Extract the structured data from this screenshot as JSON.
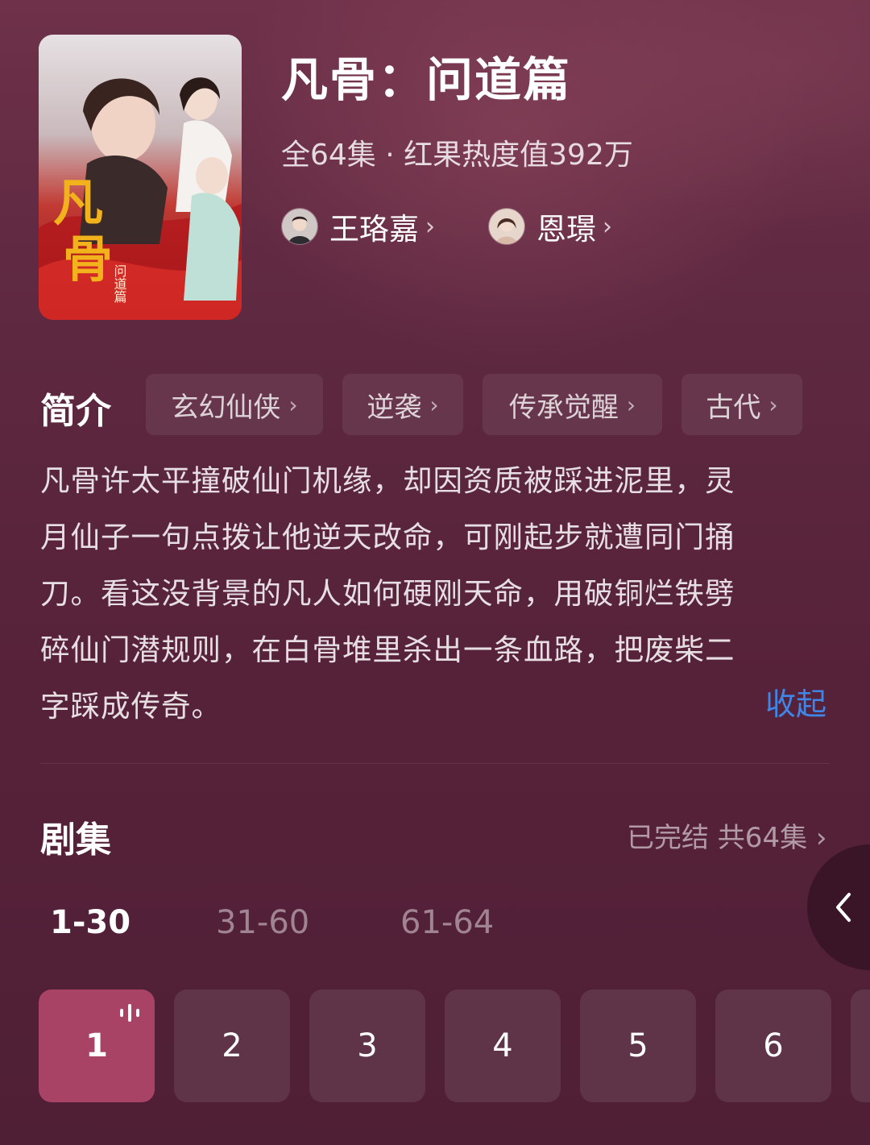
{
  "colors": {
    "accent_link": "#3f86e6",
    "active_episode": "#a84366",
    "background": "#58243a"
  },
  "drama": {
    "title": "凡骨：问道篇",
    "meta": "全64集 · 红果热度值392万",
    "poster_icon": "poster-image"
  },
  "cast": [
    {
      "name": "王珞嘉",
      "chevron": "›"
    },
    {
      "name": "恩璟",
      "chevron": "›"
    }
  ],
  "intro": {
    "heading": "简介",
    "tags": [
      {
        "label": "玄幻仙侠",
        "chevron": "›"
      },
      {
        "label": "逆袭",
        "chevron": "›"
      },
      {
        "label": "传承觉醒",
        "chevron": "›"
      },
      {
        "label": "古代",
        "chevron": "›"
      }
    ],
    "lines": [
      "凡骨许太平撞破仙门机缘，却因资质被踩进泥里，灵",
      "月仙子一句点拨让他逆天改命，可刚起步就遭同门捅",
      "刀。看这没背景的凡人如何硬刚天命，用破铜烂铁劈",
      "碎仙门潜规则，在白骨堆里杀出一条血路，把废柴二",
      "字踩成传奇。"
    ],
    "collapse_label": "收起"
  },
  "episodes": {
    "heading": "剧集",
    "status": "已完结 共64集 ›",
    "ranges": [
      "1-30",
      "31-60",
      "61-64"
    ],
    "active_range": 0,
    "items": [
      "1",
      "2",
      "3",
      "4",
      "5",
      "6"
    ],
    "active_item": 0
  }
}
